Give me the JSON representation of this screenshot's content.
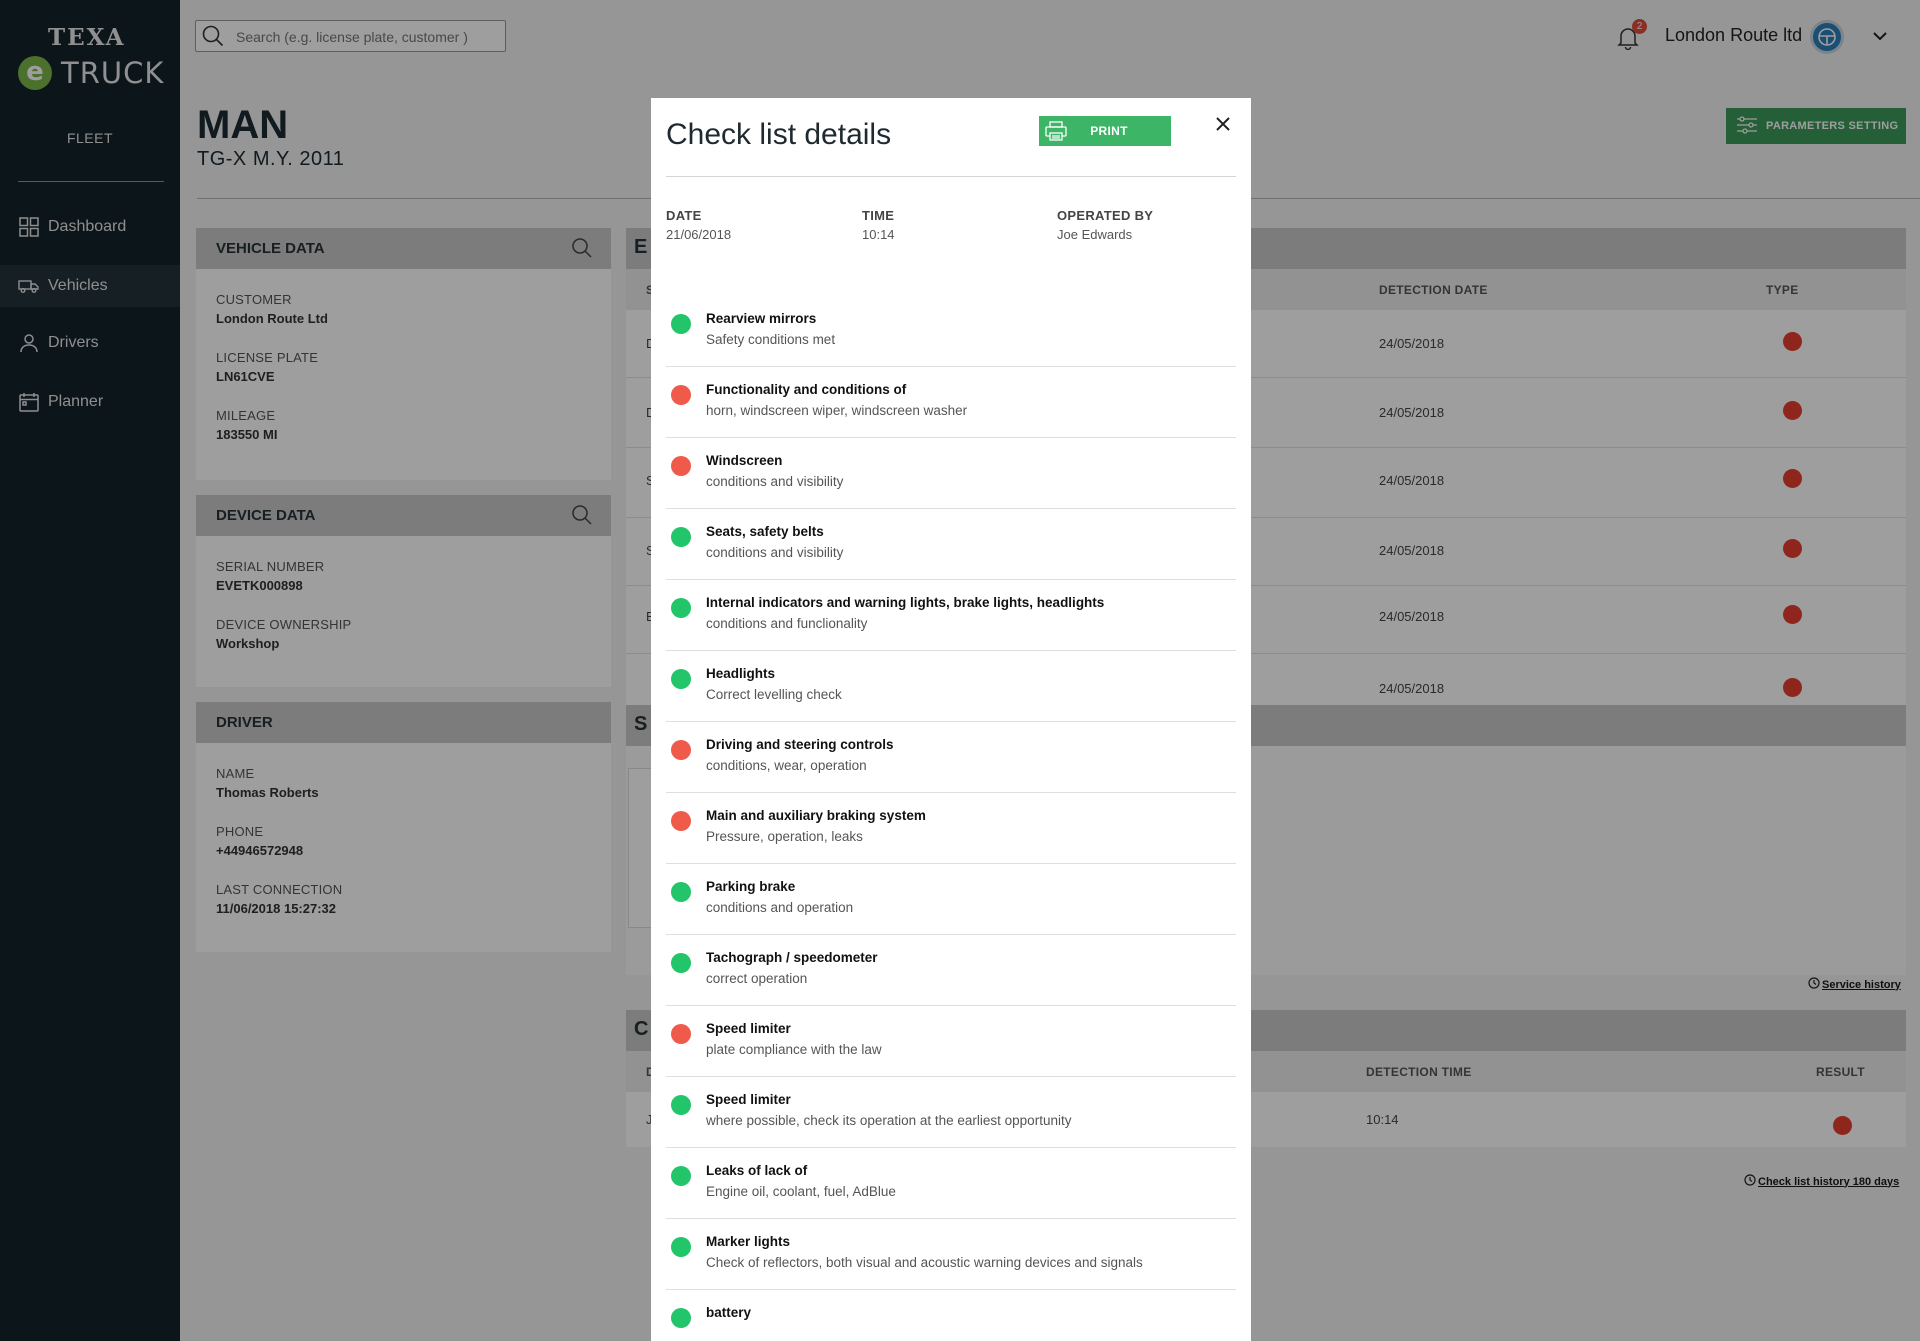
{
  "brand": {
    "texa": "TEXA",
    "e": "e",
    "truck": "TRUCK",
    "section": "FLEET"
  },
  "nav": [
    {
      "label": "Dashboard",
      "icon": "dashboard-icon"
    },
    {
      "label": "Vehicles",
      "icon": "truck-icon",
      "active": true
    },
    {
      "label": "Drivers",
      "icon": "person-icon"
    },
    {
      "label": "Planner",
      "icon": "calendar-icon"
    }
  ],
  "topbar": {
    "search_placeholder": "Search (e.g. license plate, customer )",
    "notification_count": "2",
    "company": "London Route ltd"
  },
  "vehicle": {
    "make": "MAN",
    "model": "TG-X  M.Y. 2011"
  },
  "parameters_button": "PARAMETERS SETTING",
  "vehicle_data": {
    "title": "VEHICLE DATA",
    "fields": [
      {
        "label": "CUSTOMER",
        "value": "London Route Ltd"
      },
      {
        "label": "LICENSE PLATE",
        "value": "LN61CVE"
      },
      {
        "label": "MILEAGE",
        "value": "183550 MI"
      }
    ]
  },
  "device_data": {
    "title": "DEVICE DATA",
    "fields": [
      {
        "label": "SERIAL NUMBER",
        "value": "EVETK000898"
      },
      {
        "label": "DEVICE OWNERSHIP",
        "value": "Workshop"
      }
    ]
  },
  "driver": {
    "title": "DRIVER",
    "fields": [
      {
        "label": "NAME",
        "value": "Thomas Roberts"
      },
      {
        "label": "PHONE",
        "value": "+44946572948"
      },
      {
        "label": "LAST CONNECTION",
        "value": "11/06/2018 15:27:32"
      }
    ]
  },
  "errors_panel": {
    "title_partial": "E",
    "headers": {
      "first": "S",
      "date": "DETECTION DATE",
      "type": "TYPE"
    },
    "rows": [
      {
        "code_partial": "D",
        "date": "24/05/2018",
        "type_color": "#e53e31"
      },
      {
        "code_partial": "D",
        "date": "24/05/2018",
        "type_color": "#e53e31"
      },
      {
        "code_partial": "S",
        "date": "24/05/2018",
        "type_color": "#e53e31"
      },
      {
        "code_partial": "S",
        "date": "24/05/2018",
        "type_color": "#e53e31"
      },
      {
        "code_partial": "E",
        "date": "24/05/2018",
        "type_color": "#e53e31"
      },
      {
        "code_partial": "",
        "date": "24/05/2018",
        "type_color": "#e53e31"
      }
    ]
  },
  "service_panel": {
    "title_partial": "S",
    "link": "Service history"
  },
  "checklist_panel": {
    "title_partial": "C",
    "headers": {
      "first": "D",
      "time": "DETECTION TIME",
      "result": "RESULT"
    },
    "rows": [
      {
        "partial": "J",
        "time": "10:14",
        "result_color": "#e53e31"
      }
    ],
    "link": "Check list history 180 days"
  },
  "modal": {
    "title": "Check list details",
    "print_label": "PRINT",
    "meta": [
      {
        "label": "DATE",
        "value": "21/06/2018"
      },
      {
        "label": "TIME",
        "value": "10:14"
      },
      {
        "label": "OPERATED BY",
        "value": "Joe Edwards"
      }
    ],
    "items": [
      {
        "status": "ok",
        "title": "Rearview mirrors",
        "desc": "Safety conditions met"
      },
      {
        "status": "ko",
        "title": "Functionality and conditions of",
        "desc": "horn, windscreen wiper, windscreen washer"
      },
      {
        "status": "ko",
        "title": "Windscreen",
        "desc": "conditions and visibility"
      },
      {
        "status": "ok",
        "title": "Seats, safety belts",
        "desc": "conditions and visibility"
      },
      {
        "status": "ok",
        "title": "Internal indicators and warning lights, brake lights, headlights",
        "desc": "conditions and funclionality"
      },
      {
        "status": "ok",
        "title": "Headlights",
        "desc": "Correct levelling check"
      },
      {
        "status": "ko",
        "title": "Driving and steering controls",
        "desc": "conditions, wear, operation"
      },
      {
        "status": "ko",
        "title": "Main and auxiliary braking system",
        "desc": "Pressure, operation, leaks"
      },
      {
        "status": "ok",
        "title": "Parking brake",
        "desc": "conditions and operation"
      },
      {
        "status": "ok",
        "title": "Tachograph / speedometer",
        "desc": "correct operation"
      },
      {
        "status": "ko",
        "title": "Speed limiter",
        "desc": "plate compliance with the law"
      },
      {
        "status": "ok",
        "title": "Speed limiter",
        "desc": "where possible, check its operation at the earliest opportunity"
      },
      {
        "status": "ok",
        "title": "Leaks of lack of",
        "desc": "Engine oil, coolant, fuel, AdBlue"
      },
      {
        "status": "ok",
        "title": "Marker lights",
        "desc": "Check of reflectors, both visual and acoustic warning devices and signals"
      },
      {
        "status": "ok",
        "title": "battery",
        "desc": ""
      }
    ]
  }
}
